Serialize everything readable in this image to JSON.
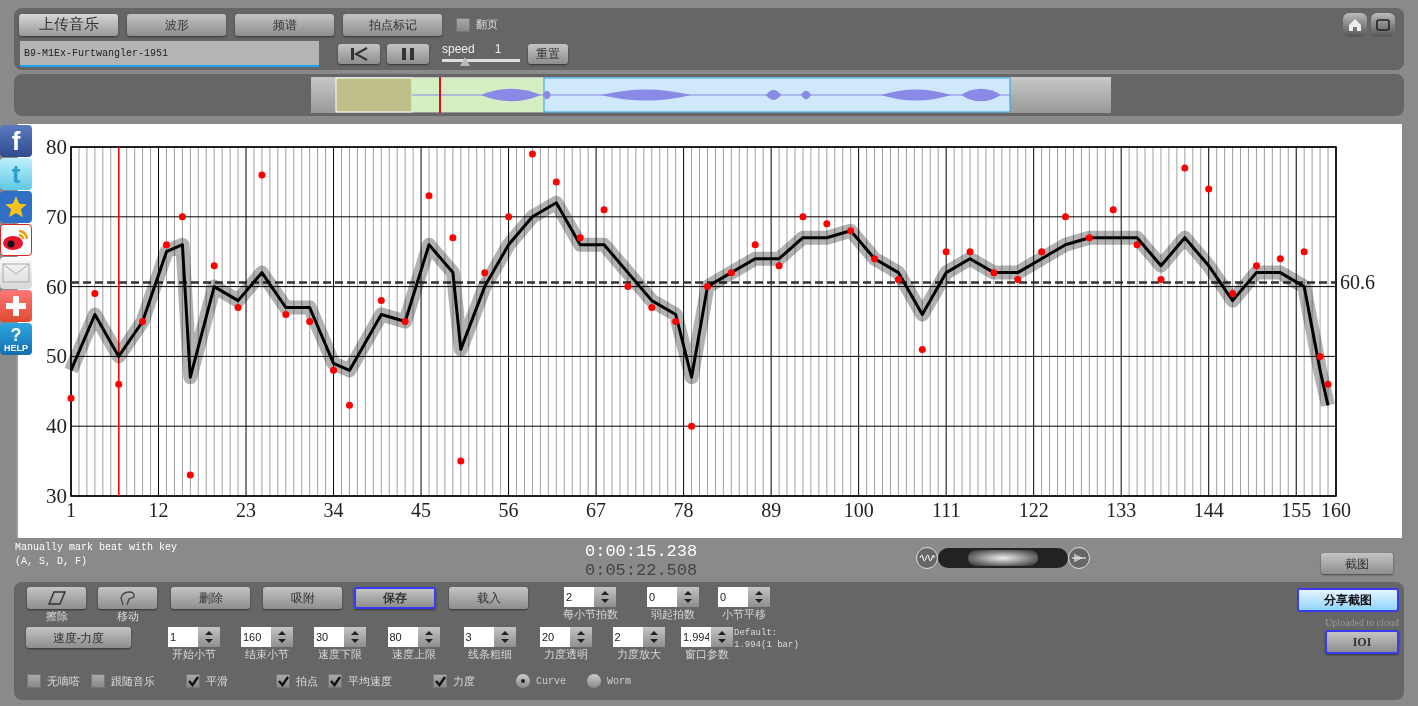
{
  "toolbar": {
    "buttons": [
      {
        "label": "上传音乐",
        "selected": true
      },
      {
        "label": "波形",
        "selected": false
      },
      {
        "label": "频谱",
        "selected": false
      },
      {
        "label": "拍点标记",
        "selected": false
      }
    ],
    "page_turn": {
      "label": "翻页",
      "checked": false
    }
  },
  "file": {
    "value": "B9-M1Ex-Furtwangler-1951"
  },
  "speed": {
    "label": "speed",
    "value": "1",
    "level": 0.3,
    "reset": "重置"
  },
  "overview": {
    "level": 0.16
  },
  "share_icons": [
    {
      "kind": "facebook",
      "glyph": "f"
    },
    {
      "kind": "twitter",
      "glyph": "t"
    },
    {
      "kind": "star"
    },
    {
      "kind": "weibo"
    },
    {
      "kind": "mail"
    },
    {
      "kind": "plus"
    },
    {
      "kind": "help",
      "glyph": "?",
      "label": "HELP"
    }
  ],
  "chart_data": {
    "type": "line",
    "x": [
      1,
      4,
      7,
      10,
      13,
      15,
      16,
      19,
      22,
      25,
      28,
      31,
      34,
      36,
      40,
      43,
      46,
      49,
      50,
      53,
      56,
      59,
      62,
      65,
      68,
      71,
      74,
      77,
      79,
      81,
      84,
      87,
      90,
      93,
      96,
      99,
      102,
      105,
      108,
      111,
      114,
      117,
      120,
      123,
      126,
      129,
      132,
      135,
      138,
      141,
      144,
      147,
      150,
      153,
      156,
      158,
      159
    ],
    "grid": true,
    "series": [
      {
        "type": "line",
        "color": "#000000",
        "values": [
          48,
          56,
          50,
          55,
          65,
          66,
          47,
          60,
          58,
          62,
          57,
          57,
          49,
          48,
          56,
          55,
          66,
          62,
          51,
          60,
          66,
          70,
          72,
          66,
          66,
          62,
          58,
          56,
          47,
          60,
          62,
          64,
          64,
          67,
          67,
          68,
          64,
          62,
          56,
          62,
          64,
          62,
          62,
          64,
          66,
          67,
          67,
          67,
          63,
          67,
          63,
          58,
          62,
          62,
          60,
          48,
          43
        ]
      },
      {
        "type": "scatter",
        "color": "#ff0000",
        "values": [
          44,
          59,
          46,
          55,
          66,
          70,
          33,
          63,
          57,
          76,
          56,
          55,
          48,
          43,
          58,
          55,
          73,
          67,
          35,
          62,
          70,
          79,
          75,
          67,
          71,
          60,
          57,
          55,
          40,
          60,
          62,
          66,
          63,
          70,
          69,
          68,
          64,
          61,
          51,
          65,
          65,
          62,
          61,
          65,
          70,
          67,
          71,
          66,
          61,
          77,
          74,
          59,
          63,
          64,
          65,
          50,
          46
        ]
      }
    ],
    "xlim": [
      1,
      160
    ],
    "ylim": [
      30,
      80
    ],
    "xticks": [
      1,
      12,
      23,
      34,
      45,
      56,
      67,
      78,
      89,
      100,
      111,
      122,
      133,
      144,
      155,
      160
    ],
    "yticks": [
      30,
      40,
      50,
      60,
      70,
      80
    ],
    "ref_lines": [
      {
        "axis": "y",
        "value": 60.6,
        "label": "60.6"
      },
      {
        "axis": "x",
        "value": 7,
        "color": "#ff0000"
      }
    ]
  },
  "mix": {
    "level": 0.5
  },
  "hint": [
    "Manually mark beat with key",
    "(A, S, D, F)"
  ],
  "times": {
    "current": "0:00:15.238",
    "total": "0:05:22.508"
  },
  "screenshot_button": "截图",
  "tools": [
    {
      "kind": "eraser",
      "label": "擦除",
      "selected": false
    },
    {
      "kind": "move",
      "label": "移动",
      "selected": false
    },
    {
      "kind": "plain",
      "label": "删除",
      "selected": false
    },
    {
      "kind": "plain",
      "label": "吸附",
      "selected": false
    },
    {
      "kind": "plain",
      "label": "保存",
      "selected": true
    },
    {
      "kind": "plain",
      "label": "载入",
      "selected": false
    }
  ],
  "beat_spinners": [
    {
      "value": "2",
      "label": "每小节拍数"
    },
    {
      "value": "0",
      "label": "弱起拍数"
    },
    {
      "value": "0",
      "label": "小节平移"
    }
  ],
  "mode_button": "速度-力度",
  "param_spinners": [
    {
      "value": "1",
      "label": "开始小节"
    },
    {
      "value": "160",
      "label": "结束小节"
    },
    {
      "value": "30",
      "label": "速度下限"
    },
    {
      "value": "80",
      "label": "速度上限"
    },
    {
      "value": "3",
      "label": "线条粗细"
    },
    {
      "value": "20",
      "label": "力度透明"
    },
    {
      "value": "2",
      "label": "力度放大"
    },
    {
      "value": "1.994",
      "label": "窗口参数"
    }
  ],
  "default_note": [
    "Default:",
    "1.994(1 bar)"
  ],
  "share": {
    "label": "分享截图",
    "note": "Uploaded to cloud"
  },
  "ioi_button": "IOI",
  "options": [
    {
      "kind": "checkbox",
      "label": "无嘀嗒",
      "checked": false
    },
    {
      "kind": "checkbox",
      "label": "跟随音乐",
      "checked": false
    },
    {
      "kind": "checkbox",
      "label": "平滑",
      "checked": true
    },
    {
      "kind": "checkbox",
      "label": "拍点",
      "checked": true
    },
    {
      "kind": "checkbox",
      "label": "平均速度",
      "checked": true
    },
    {
      "kind": "checkbox",
      "label": "力度",
      "checked": true
    },
    {
      "kind": "radio",
      "label": "Curve",
      "selected": true
    },
    {
      "kind": "radio",
      "label": "Worm",
      "selected": false
    }
  ]
}
